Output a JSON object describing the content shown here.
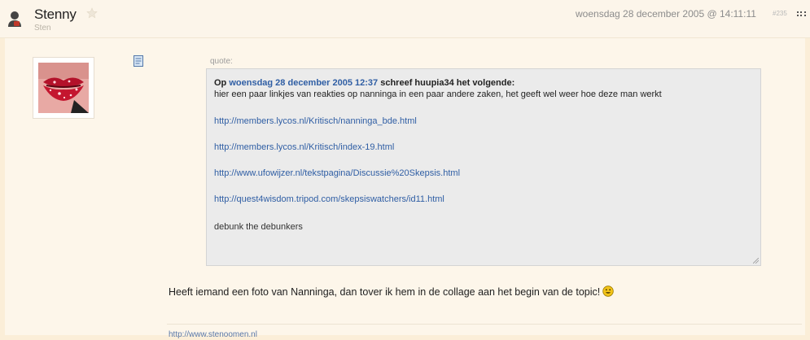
{
  "post": {
    "username": "Stenny",
    "user_title": "Sten",
    "date": "woensdag 28 december 2005 @ 14:11:11",
    "post_number": "#235"
  },
  "quote": {
    "label": "quote:",
    "head_prefix": "Op ",
    "head_date_link": "woensdag 28 december 2005 12:37",
    "head_suffix": " schreef huupia34 het volgende:",
    "text": "hier een paar linkjes van reakties op nanninga in een paar andere zaken, het geeft wel weer hoe deze man werkt",
    "links": [
      "http://members.lycos.nl/Kritisch/nanninga_bde.html",
      "http://members.lycos.nl/Kritisch/index-19.html",
      "http://www.ufowijzer.nl/tekstpagina/Discussie%20Skepsis.html",
      "http://quest4wisdom.tripod.com/skepsiswatchers/id11.html"
    ],
    "footer": "debunk the debunkers"
  },
  "message": "Heeft iemand een foto van Nanninga, dan tover ik hem in de collage aan het begin van de topic!",
  "signature": "http://www.stenoomen.nl",
  "colors": {
    "link": "#2f5ea4",
    "quote_bg": "#ebebeb",
    "page_bg": "#fdf6ea"
  }
}
